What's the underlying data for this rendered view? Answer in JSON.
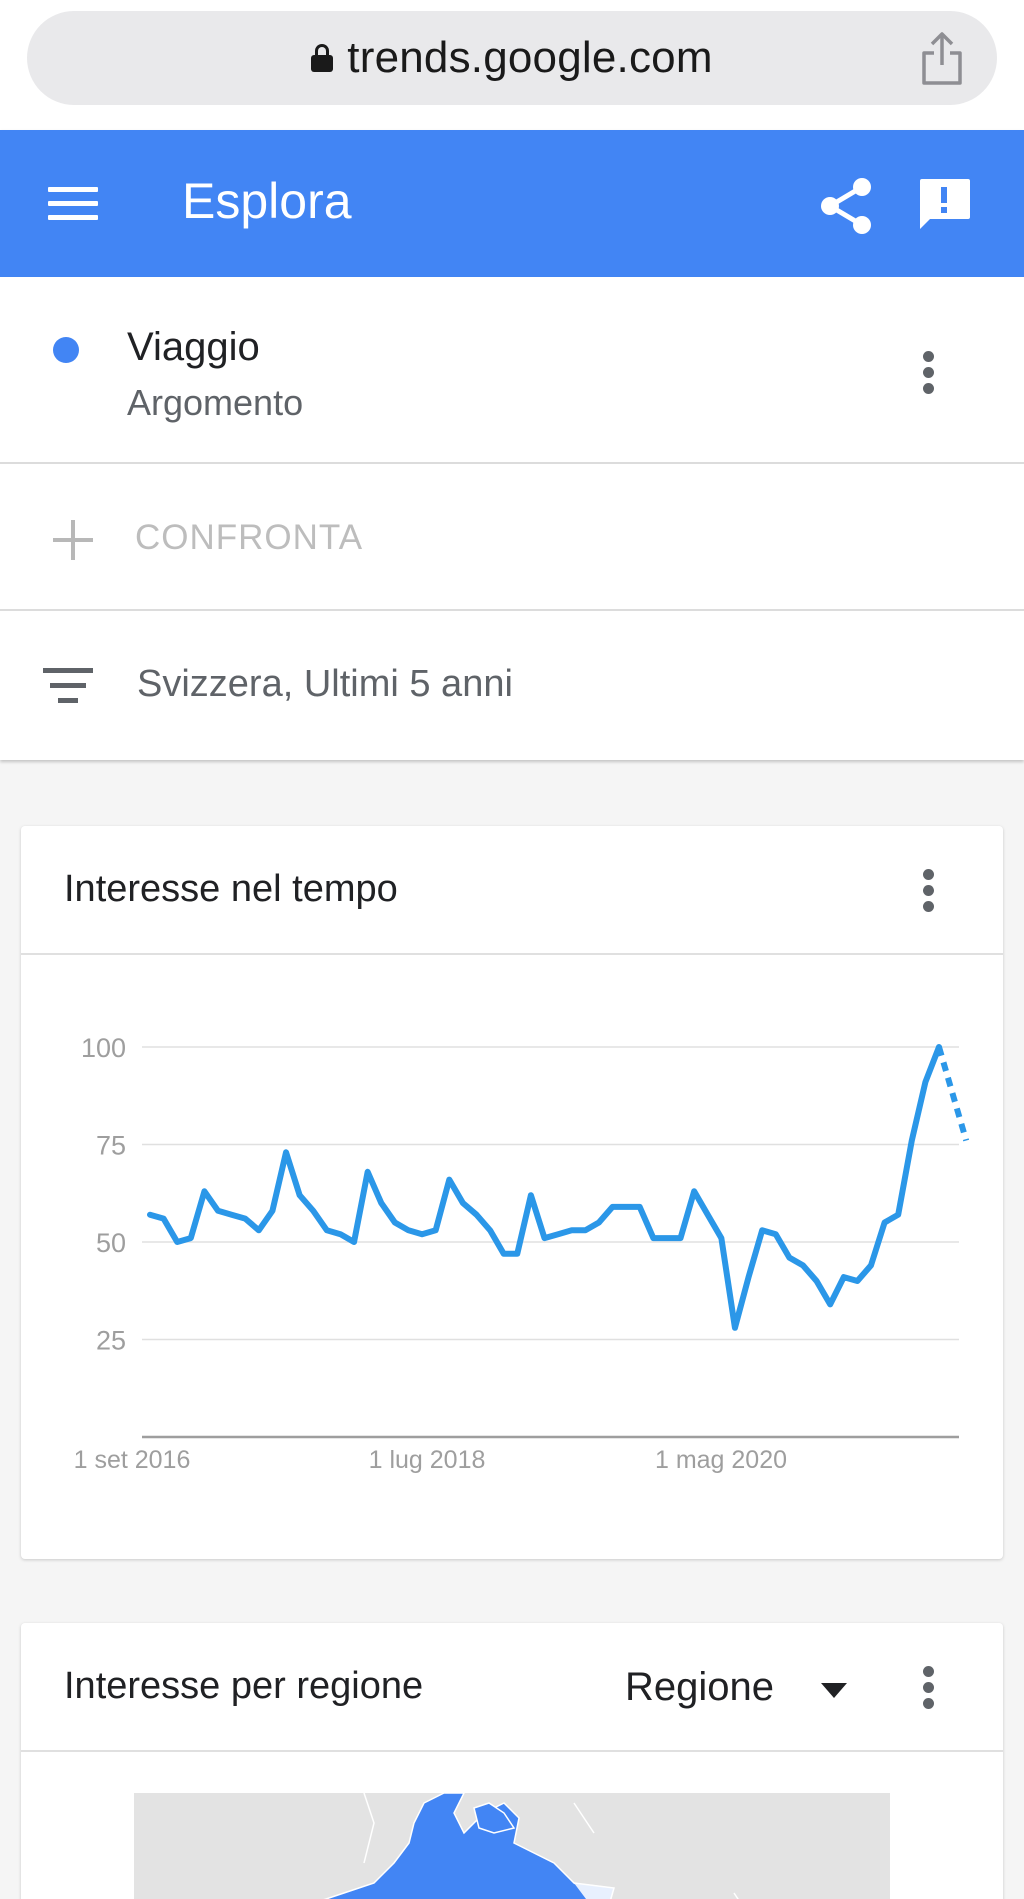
{
  "browser": {
    "url": "trends.google.com"
  },
  "app_bar": {
    "title": "Esplora"
  },
  "search_term": {
    "name": "Viaggio",
    "type": "Argomento",
    "color": "#4285f4"
  },
  "compare": {
    "label": "CONFRONTA"
  },
  "filter": {
    "label": "Svizzera, Ultimi 5 anni"
  },
  "interest_over_time": {
    "title": "Interesse nel tempo"
  },
  "interest_by_region": {
    "title": "Interesse per regione",
    "select_value": "Regione"
  },
  "colors": {
    "accent": "#4285f4",
    "line": "#2b97e8"
  },
  "chart_data": {
    "type": "line",
    "title": "",
    "xlabel": "",
    "ylabel": "",
    "ylim": [
      0,
      100
    ],
    "yticks": [
      25,
      50,
      75,
      100
    ],
    "x_tick_labels": [
      "1 set 2016",
      "1 lug 2018",
      "1 mag 2020"
    ],
    "grid": true,
    "series": [
      {
        "values": [
          57,
          56,
          50,
          51,
          63,
          58,
          57,
          56,
          53,
          58,
          73,
          62,
          58,
          53,
          52,
          50,
          68,
          60,
          55,
          53,
          52,
          53,
          66,
          60,
          57,
          53,
          47,
          47,
          62,
          51,
          52,
          53,
          53,
          55,
          59,
          59,
          59,
          51,
          51,
          51,
          63,
          57,
          51,
          28,
          41,
          53,
          52,
          46,
          44,
          40,
          34,
          41,
          40,
          44,
          55,
          57,
          76,
          91,
          100
        ],
        "partial_values": [
          100,
          76
        ]
      }
    ]
  }
}
